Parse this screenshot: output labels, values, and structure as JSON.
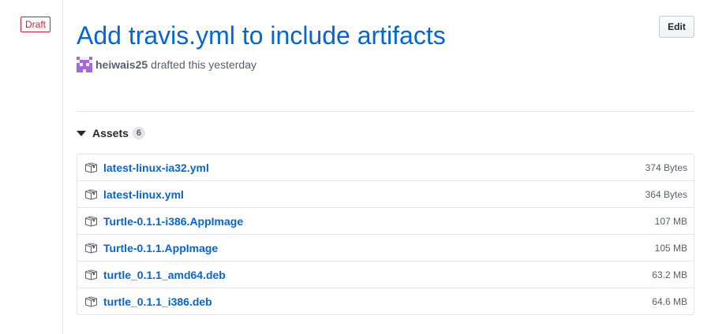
{
  "release": {
    "status_badge": "Draft",
    "title": "Add travis.yml to include artifacts",
    "edit_label": "Edit",
    "author": "heiwais25",
    "byline_suffix": "drafted this yesterday"
  },
  "assets": {
    "label": "Assets",
    "count": "6",
    "items": [
      {
        "name": "latest-linux-ia32.yml",
        "size": "374 Bytes",
        "icon": "package-icon"
      },
      {
        "name": "latest-linux.yml",
        "size": "364 Bytes",
        "icon": "package-icon"
      },
      {
        "name": "Turtle-0.1.1-i386.AppImage",
        "size": "107 MB",
        "icon": "package-icon"
      },
      {
        "name": "Turtle-0.1.1.AppImage",
        "size": "105 MB",
        "icon": "package-icon"
      },
      {
        "name": "turtle_0.1.1_amd64.deb",
        "size": "63.2 MB",
        "icon": "package-icon"
      },
      {
        "name": "turtle_0.1.1_i386.deb",
        "size": "64.6 MB",
        "icon": "package-icon"
      }
    ]
  },
  "colors": {
    "link": "#0366d6",
    "draft_red": "#cb2431",
    "muted": "#586069",
    "avatar": "#a06ad8"
  }
}
